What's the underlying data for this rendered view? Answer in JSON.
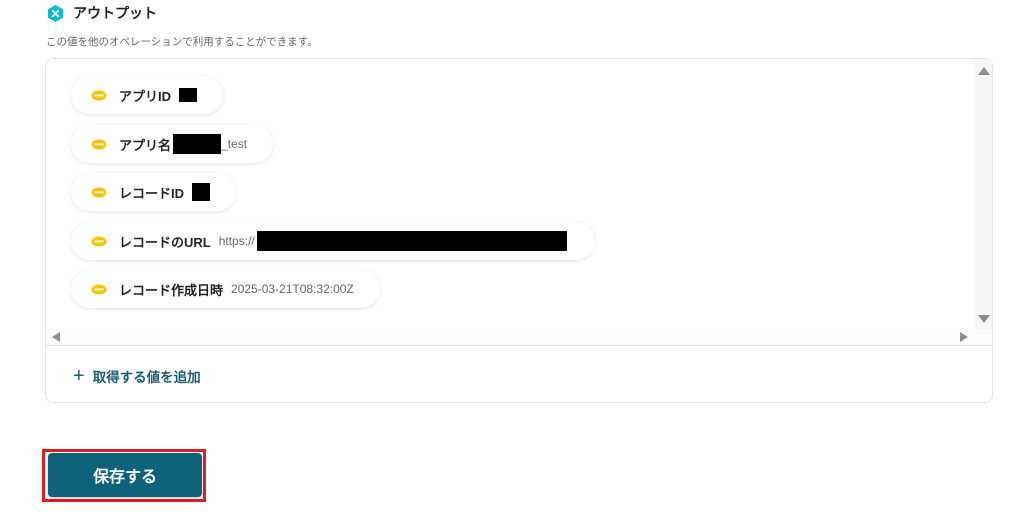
{
  "section": {
    "title": "アウトプット",
    "description": "この値を他のオペレーションで利用することができます。",
    "icon": "yoom-hexagon-icon",
    "icon_color": "#12b6d6"
  },
  "outputs": [
    {
      "label": "アプリID",
      "value": "",
      "redacted": true
    },
    {
      "label": "アプリ名",
      "value": "_test",
      "redacted": true
    },
    {
      "label": "レコードID",
      "value": "",
      "redacted": true
    },
    {
      "label": "レコードのURL",
      "value": "https://",
      "redacted": true
    },
    {
      "label": "レコード作成日時",
      "value": "2025-03-21T08:32:00Z",
      "redacted": false
    }
  ],
  "chip_icon": "kintone-cloud-icon",
  "chip_icon_color": "#f5c400",
  "add_button": {
    "label": "取得する値を追加",
    "icon": "plus-icon"
  },
  "save_button": {
    "label": "保存する",
    "color": "#0e6279",
    "highlight_color": "#e02020"
  }
}
